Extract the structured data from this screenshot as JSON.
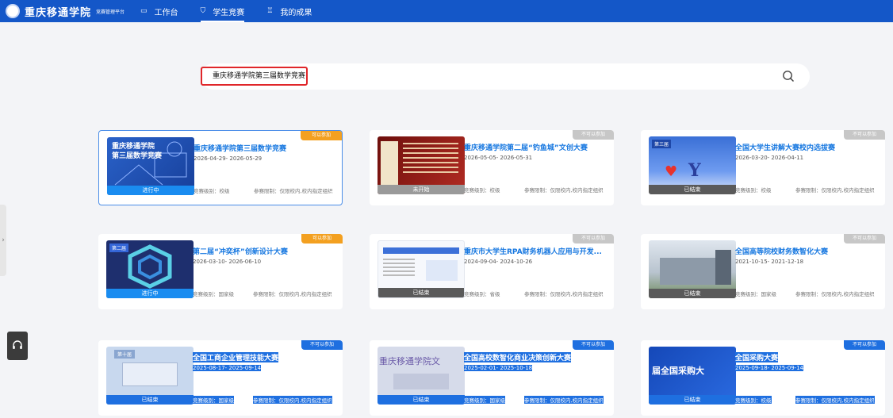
{
  "header": {
    "logo_text": "重庆移通学院",
    "logo_subtitle": "竞赛管理平台",
    "nav": [
      {
        "label": "工作台",
        "icon": "workbench-icon"
      },
      {
        "label": "学生竞赛",
        "icon": "shield-icon",
        "active": true
      },
      {
        "label": "我的成果",
        "icon": "trophy-icon"
      }
    ]
  },
  "search": {
    "value": "重庆移通学院第三届数学竞赛",
    "icon": "search-icon"
  },
  "cards": [
    {
      "title": "重庆移通学院第三届数学竞赛",
      "dates": "2026-04-29- 2026-05-29",
      "level": "竞赛级别：校级",
      "scope": "参赛限制：仅限校内,校内指定组织",
      "badge": "可以参加",
      "status": "进行中",
      "thumb": {
        "overlay": "重庆移通学院\n第三届数学竞赛"
      }
    },
    {
      "title": "重庆移通学院第二届“钓鱼城”文创大赛",
      "dates": "2026-05-05- 2026-05-31",
      "level": "竞赛级别：校级",
      "scope": "参赛限制：仅限校内,校内指定组织",
      "badge": "不可以参加",
      "status": "未开始",
      "thumb": {
        "overlay": ""
      }
    },
    {
      "title": "全国大学生讲解大赛校内选拔赛",
      "dates": "2026-03-20- 2026-04-11",
      "level": "竞赛级别：校级",
      "scope": "参赛限制：仅限校内,校内指定组织",
      "badge": "不可以参加",
      "status": "已结束",
      "thumb": {
        "overlay": "第三届"
      }
    },
    {
      "title": "第二届“冲奕杯”创新设计大赛",
      "dates": "2026-03-10- 2026-06-10",
      "level": "竞赛级别：国家级",
      "scope": "参赛限制：仅限校内,校内指定组织",
      "badge": "可以参加",
      "status": "进行中",
      "thumb": {
        "overlay": "第二届"
      }
    },
    {
      "title": "重庆市大学生RPA财务机器人应用与开发...",
      "dates": "2024-09-04- 2024-10-26",
      "level": "竞赛级别：省级",
      "scope": "参赛限制：仅限校内,校内指定组织",
      "badge": "不可以参加",
      "status": "已结束",
      "thumb": {
        "overlay": ""
      }
    },
    {
      "title": "全国高等院校财务数智化大赛",
      "dates": "2021-10-15- 2021-12-18",
      "level": "竞赛级别：国家级",
      "scope": "参赛限制：仅限校内,校内指定组织",
      "badge": "不可以参加",
      "status": "已结束",
      "thumb": {
        "overlay": ""
      }
    },
    {
      "title": "全国工商企业管理技能大赛",
      "dates": "2025-08-17- 2025-09-14",
      "level": "竞赛级别：国家级",
      "scope": "参赛限制：仅限校内,校内指定组织",
      "badge": "不可以参加",
      "status": "已结束",
      "thumb": {
        "overlay": "第十届"
      }
    },
    {
      "title": "全国高校数智化商业决策创新大赛",
      "dates": "2025-02-01- 2025-10-18",
      "level": "竞赛级别：国家级",
      "scope": "参赛限制：仅限校内,校内指定组织",
      "badge": "不可以参加",
      "status": "已结束",
      "thumb": {
        "overlay": "重庆移通学院文"
      }
    },
    {
      "title": "全国采购大赛",
      "dates": "2025-09-18- 2025-09-14",
      "level": "竞赛级别：校级",
      "scope": "参赛限制：仅限校内,校内指定组织",
      "badge": "不可以参加",
      "status": "已结束",
      "thumb": {
        "overlay": "届全国采购大"
      }
    }
  ],
  "colors": {
    "brand": "#1457c8",
    "link": "#1677e0",
    "badge_ok": "#f3a020",
    "badge_no": "#c7c7c7",
    "running": "#1a8cf0",
    "ended": "#5a5a5a"
  }
}
